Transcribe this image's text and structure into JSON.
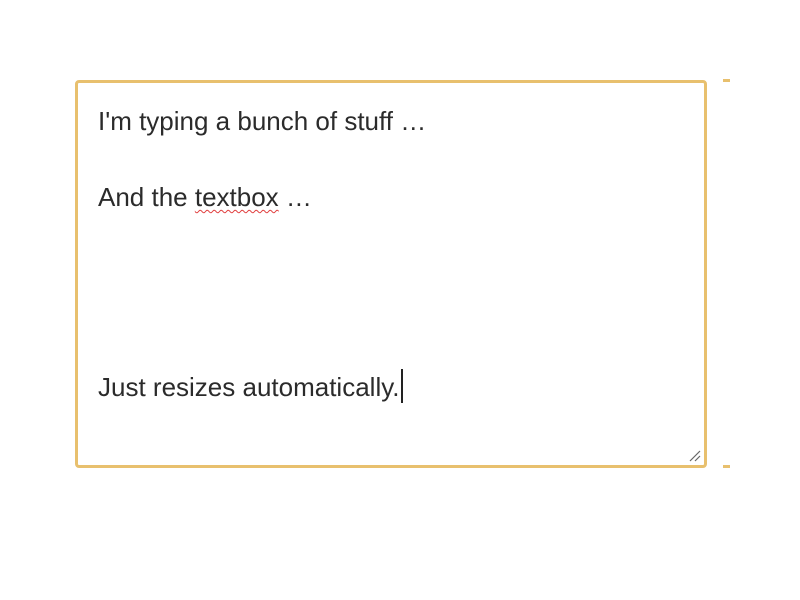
{
  "textarea": {
    "lines": [
      "I'm typing a bunch of stuff …",
      "",
      "And the ",
      "textbox",
      " …",
      "",
      "",
      "",
      "",
      "Just resizes automatically."
    ]
  },
  "colors": {
    "focus_border": "#e8c06e",
    "text": "#2b2b2b",
    "spellcheck_underline": "#e03c3c"
  },
  "icons": {
    "resize_grip": "resize-grip-icon"
  }
}
